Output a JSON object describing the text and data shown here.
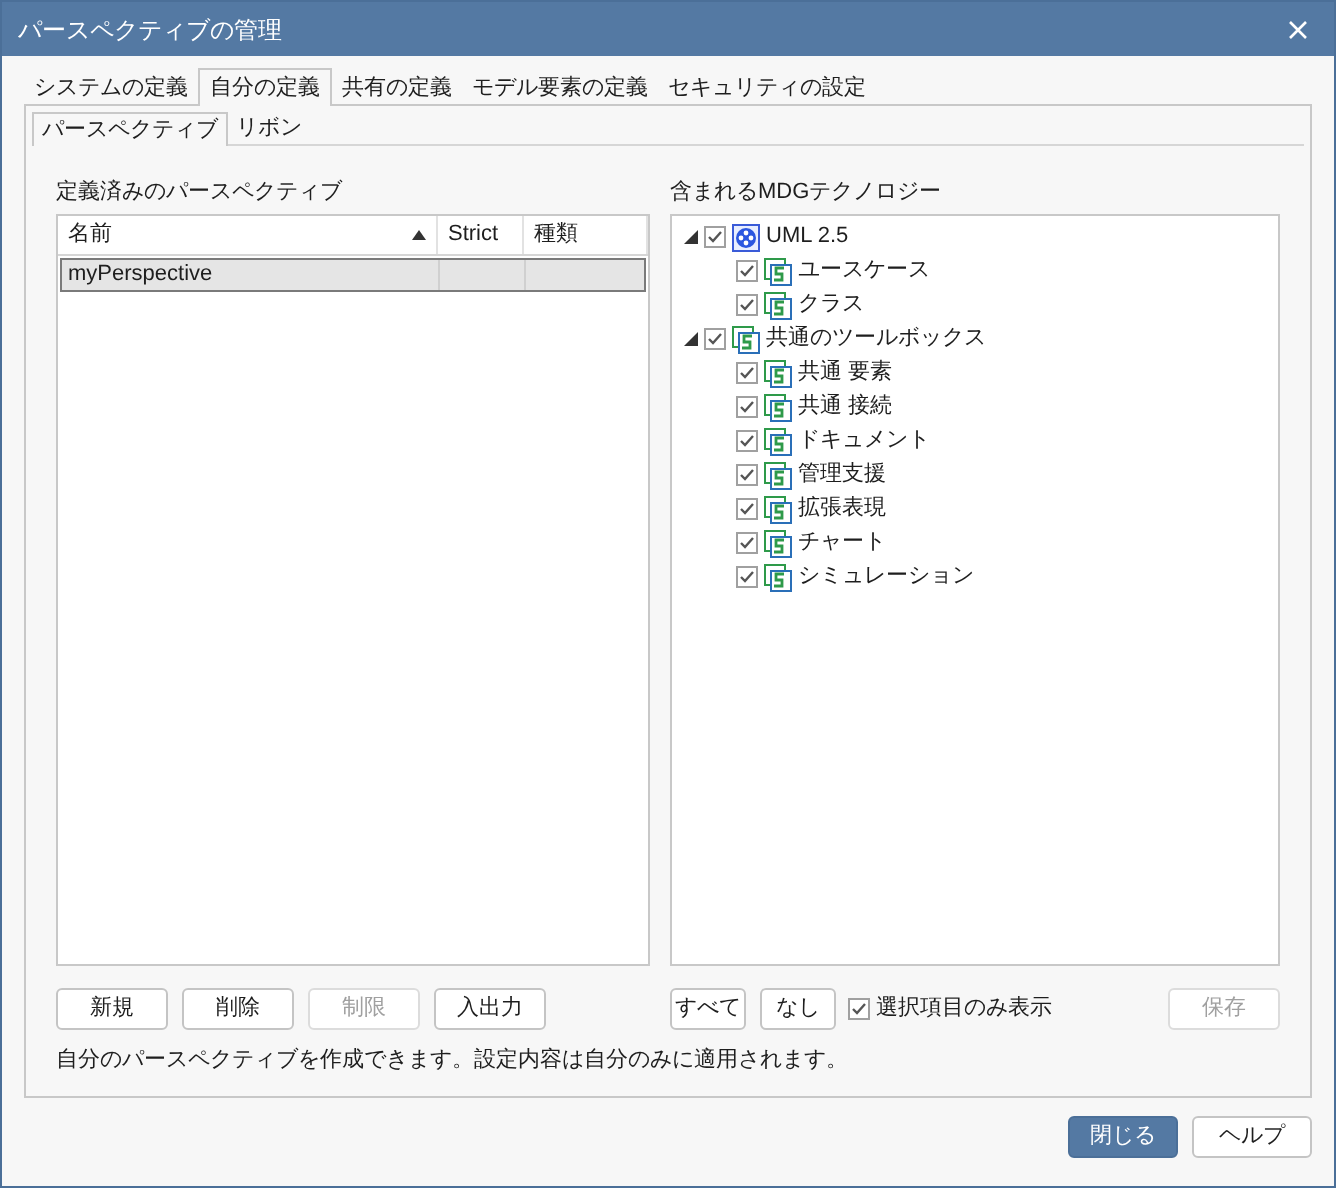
{
  "window": {
    "title": "パースペクティブの管理"
  },
  "tabs": [
    {
      "label": "システムの定義",
      "selected": false
    },
    {
      "label": "自分の定義",
      "selected": true
    },
    {
      "label": "共有の定義",
      "selected": false
    },
    {
      "label": "モデル要素の定義",
      "selected": false
    },
    {
      "label": "セキュリティの設定",
      "selected": false
    }
  ],
  "subtabs": [
    {
      "label": "パースペクティブ",
      "selected": true
    },
    {
      "label": "リボン",
      "selected": false
    }
  ],
  "perspectives": {
    "label": "定義済みのパースペクティブ",
    "columns": [
      {
        "label": "名前",
        "sorted": true
      },
      {
        "label": "Strict",
        "sorted": false
      },
      {
        "label": "種類",
        "sorted": false
      }
    ],
    "rows": [
      {
        "name": "myPerspective",
        "selected": true
      }
    ]
  },
  "technologies": {
    "label": "含まれるMDGテクノロジー",
    "tree": [
      {
        "label": "UML 2.5",
        "kind": "uml",
        "checked": true,
        "expanded": true,
        "children": [
          {
            "label": "ユースケース",
            "kind": "toolbox",
            "checked": true
          },
          {
            "label": "クラス",
            "kind": "toolbox",
            "checked": true
          }
        ]
      },
      {
        "label": "共通のツールボックス",
        "kind": "toolbox",
        "checked": true,
        "expanded": true,
        "children": [
          {
            "label": "共通 要素",
            "kind": "toolbox",
            "checked": true
          },
          {
            "label": "共通 接続",
            "kind": "toolbox",
            "checked": true
          },
          {
            "label": "ドキュメント",
            "kind": "toolbox",
            "checked": true
          },
          {
            "label": "管理支援",
            "kind": "toolbox",
            "checked": true
          },
          {
            "label": "拡張表現",
            "kind": "toolbox",
            "checked": true
          },
          {
            "label": "チャート",
            "kind": "toolbox",
            "checked": true
          },
          {
            "label": "シミュレーション",
            "kind": "toolbox",
            "checked": true
          }
        ]
      }
    ]
  },
  "left_buttons": [
    {
      "label": "新規",
      "disabled": false
    },
    {
      "label": "削除",
      "disabled": false
    },
    {
      "label": "制限",
      "disabled": true
    },
    {
      "label": "入出力",
      "disabled": false
    }
  ],
  "right_buttons": [
    {
      "label": "すべて",
      "disabled": false
    },
    {
      "label": "なし",
      "disabled": false
    }
  ],
  "selected_only": {
    "label": "選択項目のみ表示",
    "checked": true
  },
  "save_button": {
    "label": "保存",
    "disabled": true
  },
  "description": "自分のパースペクティブを作成できます。設定内容は自分のみに適用されます。",
  "footer_buttons": [
    {
      "label": "閉じる",
      "primary": true
    },
    {
      "label": "ヘルプ",
      "primary": false
    }
  ]
}
